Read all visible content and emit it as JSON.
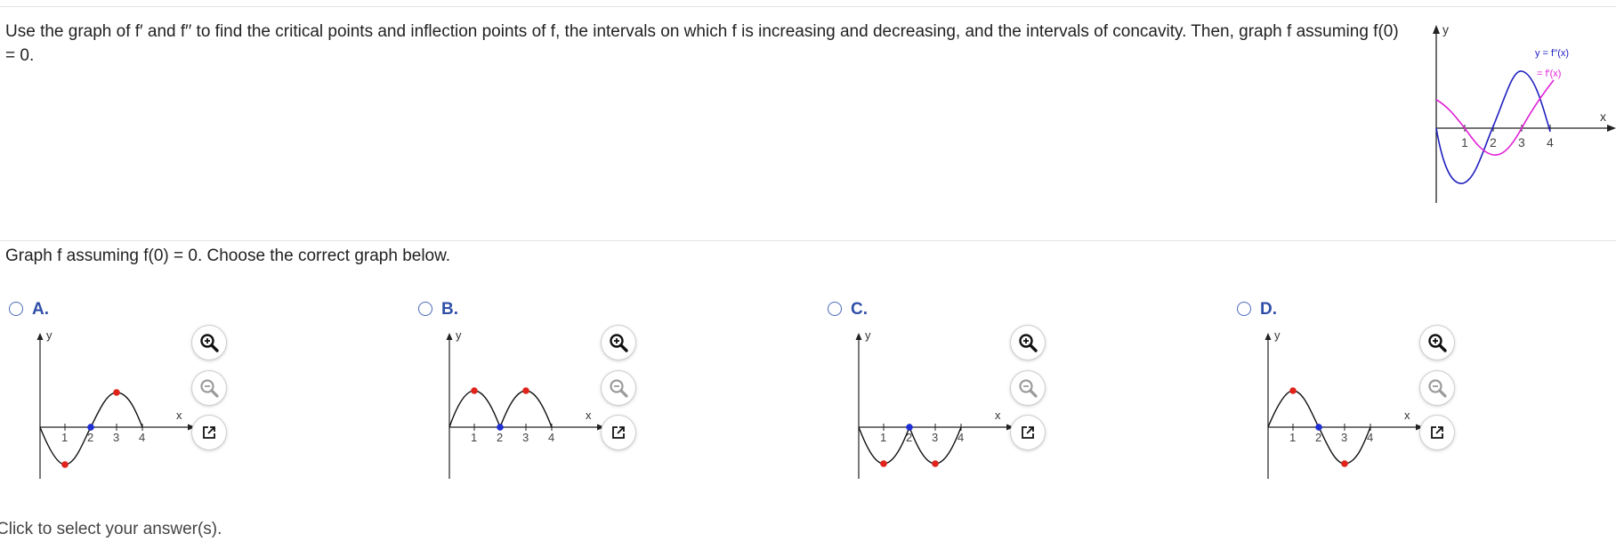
{
  "question": {
    "text": "Use the graph of f′ and f′′ to find the critical points and inflection points of f, the intervals on which f is increasing and decreasing, and the intervals of concavity. Then, graph f assuming f(0) = 0."
  },
  "main_graph": {
    "y_axis_label": "y",
    "x_axis_label": "x",
    "x_ticks": [
      "1",
      "2",
      "3",
      "4"
    ],
    "labels": {
      "second_derivative": "y = f′′(x)",
      "first_derivative": "= f′(x)"
    },
    "colors": {
      "first_derivative": "#2020c0",
      "second_derivative": "#e020d8"
    }
  },
  "prompt": {
    "text": "Graph f assuming f(0) = 0. Choose the correct graph below."
  },
  "options": [
    {
      "letter": "A.",
      "y_label": "y",
      "x_label": "x",
      "ticks": [
        "1",
        "2",
        "3",
        "4"
      ]
    },
    {
      "letter": "B.",
      "y_label": "y",
      "x_label": "x",
      "ticks": [
        "1",
        "2",
        "3",
        "4"
      ]
    },
    {
      "letter": "C.",
      "y_label": "y",
      "x_label": "x",
      "ticks": [
        "1",
        "2",
        "3",
        "4"
      ]
    },
    {
      "letter": "D.",
      "y_label": "y",
      "x_label": "x",
      "ticks": [
        "1",
        "2",
        "3",
        "4"
      ]
    }
  ],
  "tools": [
    "zoom-in-icon",
    "zoom-out-icon",
    "external-link-icon"
  ],
  "footer": {
    "text": "Click to select your answer(s)."
  },
  "colors": {
    "critical_point": "#e0241c",
    "inflection_point": "#1f2fd6",
    "option_letter": "#2f4fa8"
  }
}
